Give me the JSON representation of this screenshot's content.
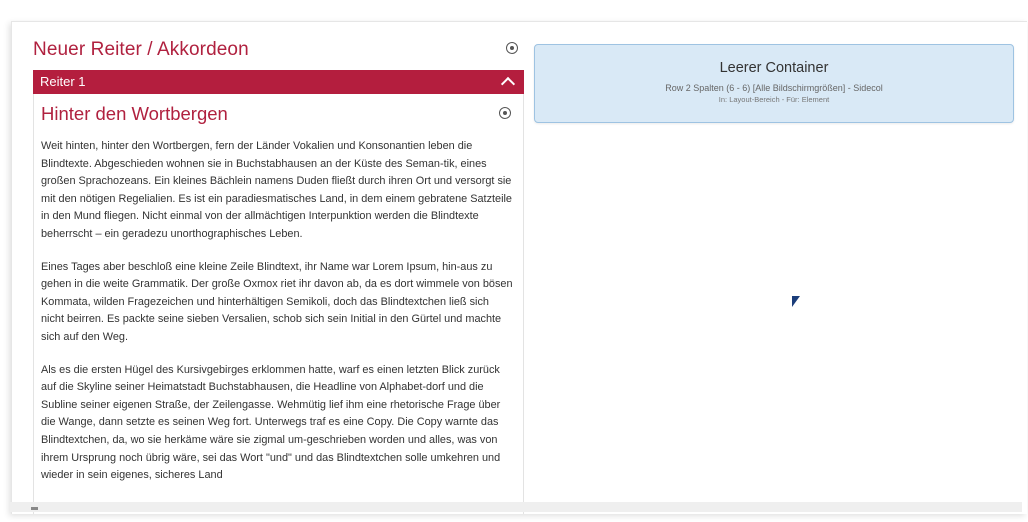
{
  "accordion": {
    "title": "Neuer Reiter / Akkordeon",
    "tab_label": "Reiter 1",
    "section_title": "Hinter den Wortbergen",
    "paragraphs": [
      "Weit hinten, hinter den Wortbergen, fern der Länder Vokalien und Konsonantien leben die Blindtexte. Abgeschieden wohnen sie in Buchstabhausen an der Küste des Seman-tik, eines großen Sprachozeans. Ein kleines Bächlein namens Duden fließt durch ihren Ort und versorgt sie mit den nötigen Regelialien. Es ist ein paradiesmatisches Land, in dem einem gebratene Satzteile in den Mund fliegen. Nicht einmal von der allmächtigen Interpunktion werden die Blindtexte beherrscht – ein geradezu unorthographisches Leben.",
      "Eines Tages aber beschloß eine kleine Zeile Blindtext, ihr Name war Lorem Ipsum, hin-aus zu gehen in die weite Grammatik. Der große Oxmox riet ihr davon ab, da es dort wimmele von bösen Kommata, wilden Fragezeichen und hinterhältigen Semikoli, doch das Blindtextchen ließ sich nicht beirren. Es packte seine sieben Versalien, schob sich sein Initial in den Gürtel und machte sich auf den Weg.",
      "Als es die ersten Hügel des Kursivgebirges erklommen hatte, warf es einen letzten Blick zurück auf die Skyline seiner Heimatstadt Buchstabhausen, die Headline von Alphabet-dorf und die Subline seiner eigenen Straße, der Zeilengasse. Wehmütig lief ihm eine rhetorische Frage über die Wange, dann setzte es seinen Weg fort. Unterwegs traf es eine Copy. Die Copy warnte das Blindtextchen, da, wo sie herkäme wäre sie zigmal um-geschrieben worden und alles, was von ihrem Ursprung noch übrig wäre, sei das Wort \"und\" und das Blindtextchen solle umkehren und wieder in sein eigenes, sicheres Land"
    ]
  },
  "container": {
    "title": "Leerer Container",
    "subtitle": "Row 2 Spalten (6 - 6) [Alle Bildschirmgrößen] - Sidecol",
    "meta": "In: Layout-Bereich - Für: Element"
  },
  "colors": {
    "accent": "#b41e3e",
    "heading": "#b0213f",
    "container_bg": "#d9e9f6",
    "container_border": "#9ec3e2"
  },
  "icons": [
    "settings-icon",
    "chevron-up-icon",
    "mouse-cursor-icon"
  ]
}
